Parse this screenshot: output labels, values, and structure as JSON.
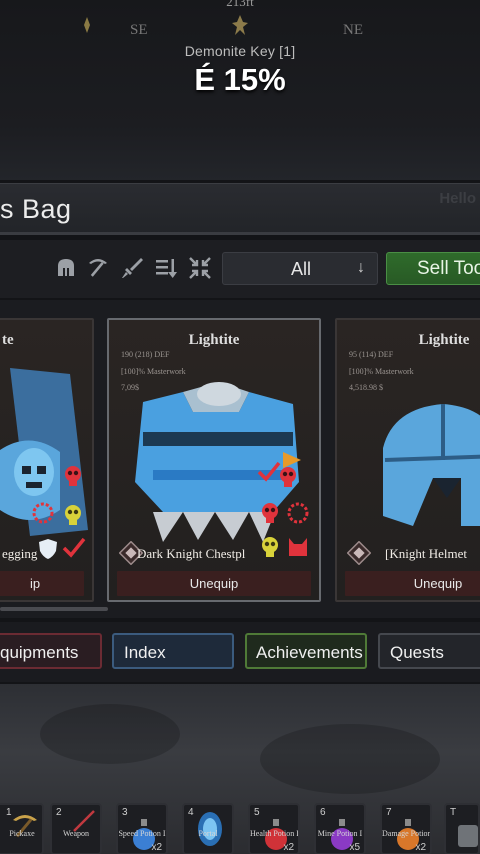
{
  "compass": {
    "distance": "213ft",
    "left_heading": "SE",
    "right_heading": "NE"
  },
  "key_drop": {
    "label": "Demonite Key [1]",
    "chance": "É 15%"
  },
  "bag": {
    "title": "s Bag",
    "corner_text": "Hello"
  },
  "toolbar": {
    "icons": [
      "helmet-icon",
      "pickaxe-icon",
      "sword-icon",
      "sort-icon",
      "collapse-icon"
    ],
    "filter": {
      "selected": "All"
    },
    "sell_label": "Sell Too"
  },
  "cards": [
    {
      "rarity": "te",
      "name": "egging",
      "action": "ip",
      "selected": false
    },
    {
      "rarity": "Lightite",
      "stat_def": "190 (218) DEF",
      "stat_quality": "[100]% Masterwork",
      "stat_price": "7,09$",
      "name": "Dark Knight Chestpl",
      "action": "Unequip",
      "selected": true
    },
    {
      "rarity": "Lightite",
      "stat_def": "95 (114) DEF",
      "stat_quality": "[100]% Masterwork",
      "stat_price": "4,518.98 $",
      "name": "[Knight Helmet",
      "action": "Unequip",
      "selected": false
    }
  ],
  "tabs": {
    "equipment": "quipments",
    "index": "Index",
    "achievements": "Achievements",
    "quests": "Quests"
  },
  "hotbar": [
    {
      "num": "1",
      "label": "Pickaxe",
      "count": ""
    },
    {
      "num": "2",
      "label": "Weapon",
      "count": ""
    },
    {
      "num": "3",
      "label": "Speed Potion I",
      "count": "x2"
    },
    {
      "num": "4",
      "label": "Portal",
      "count": ""
    },
    {
      "num": "5",
      "label": "Health Potion II",
      "count": "x2"
    },
    {
      "num": "6",
      "label": "Mine Potion I",
      "count": "x5"
    },
    {
      "num": "7",
      "label": "Damage Potion I",
      "count": "x2"
    },
    {
      "num": "T",
      "label": "",
      "count": ""
    }
  ],
  "colors": {
    "sell_green": "#2f6b2b",
    "unequip_red": "#3a1f1f",
    "skull_red": "#e0333c",
    "skull_yellow": "#d8d23a",
    "armor_blue": "#4aa0e0"
  }
}
